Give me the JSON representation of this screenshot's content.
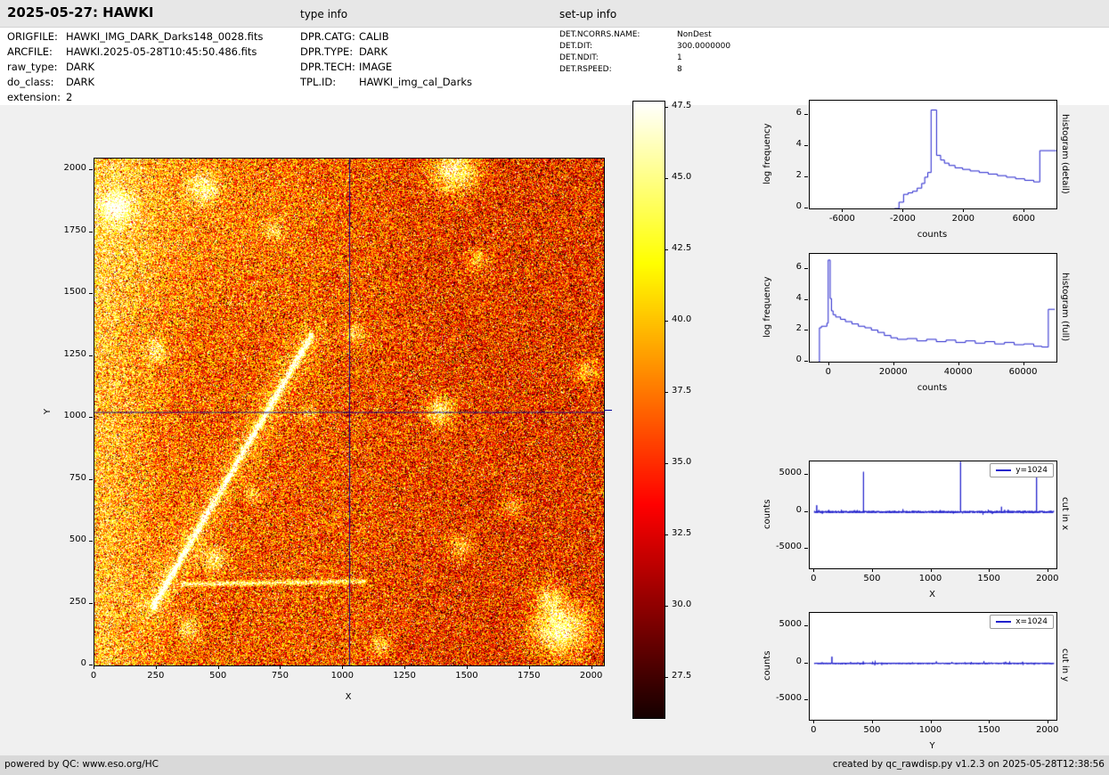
{
  "header": {
    "title": "2025-05-27: HAWKI",
    "type_info_label": "type info",
    "setup_info_label": "set-up info"
  },
  "metadata": {
    "file": [
      {
        "label": "ORIGFILE:",
        "value": "HAWKI_IMG_DARK_Darks148_0028.fits"
      },
      {
        "label": "ARCFILE:",
        "value": "HAWKI.2025-05-28T10:45:50.486.fits"
      },
      {
        "label": "raw_type:",
        "value": "DARK"
      },
      {
        "label": "do_class:",
        "value": "DARK"
      },
      {
        "label": "extension:",
        "value": "2"
      }
    ],
    "dpr": [
      {
        "label": "DPR.CATG:",
        "value": "CALIB"
      },
      {
        "label": "DPR.TYPE:",
        "value": "DARK"
      },
      {
        "label": "DPR.TECH:",
        "value": "IMAGE"
      },
      {
        "label": "TPL.ID:",
        "value": "HAWKI_img_cal_Darks"
      }
    ],
    "det": [
      {
        "label": "DET.NCORRS.NAME:",
        "value": "NonDest"
      },
      {
        "label": "DET.DIT:",
        "value": "300.0000000"
      },
      {
        "label": "DET.NDIT:",
        "value": "1"
      },
      {
        "label": "DET.RSPEED:",
        "value": "8"
      }
    ]
  },
  "main_image": {
    "xlabel": "X",
    "ylabel": "Y",
    "xlim": [
      0,
      2048
    ],
    "ylim": [
      0,
      2048
    ],
    "xticks": [
      0,
      250,
      500,
      750,
      1000,
      1250,
      1500,
      1750,
      2000
    ],
    "yticks": [
      0,
      250,
      500,
      750,
      1000,
      1250,
      1500,
      1750,
      2000
    ],
    "crosshair_x": 1024,
    "crosshair_y": 1024,
    "crosshair_color": "#000099",
    "colormap": "hot",
    "noise": {
      "seed": 42,
      "base": 0.5,
      "blobs": [
        [
          1450,
          1995,
          0.5,
          60
        ],
        [
          1870,
          150,
          0.55,
          75
        ],
        [
          1830,
          280,
          0.3,
          35
        ],
        [
          440,
          1930,
          0.38,
          40
        ],
        [
          90,
          1850,
          0.4,
          45
        ],
        [
          250,
          1270,
          0.28,
          32
        ],
        [
          1390,
          1030,
          0.4,
          42
        ],
        [
          480,
          430,
          0.33,
          38
        ],
        [
          1470,
          480,
          0.28,
          32
        ],
        [
          640,
          690,
          0.24,
          26
        ],
        [
          1050,
          1340,
          0.28,
          28
        ],
        [
          1680,
          640,
          0.24,
          28
        ],
        [
          380,
          150,
          0.3,
          32
        ],
        [
          1150,
          80,
          0.28,
          28
        ],
        [
          860,
          1015,
          0.24,
          24
        ],
        [
          1985,
          1190,
          0.28,
          30
        ],
        [
          1540,
          1640,
          0.25,
          30
        ],
        [
          720,
          1760,
          0.25,
          28
        ]
      ],
      "streaks": [
        [
          235,
          235,
          870,
          1330,
          0.5,
          9
        ],
        [
          235,
          235,
          870,
          1330,
          0.15,
          45
        ],
        [
          360,
          328,
          1085,
          340,
          0.4,
          7
        ]
      ]
    }
  },
  "colorbar": {
    "vmin": 26.1,
    "vmax": 47.72,
    "ticks": [
      27.5,
      30.0,
      32.5,
      35.0,
      37.5,
      40.0,
      42.5,
      45.0,
      47.5
    ]
  },
  "chart_data": [
    {
      "type": "line",
      "id": "hist-detail",
      "ylabel": "log frequency",
      "xlabel": "counts",
      "right_label": "histogram (detail)",
      "color": "#2222cc",
      "xlim": [
        -8200,
        8100
      ],
      "ylim": [
        0,
        6.9
      ],
      "xticks": [
        -6000,
        -2000,
        2000,
        6000
      ],
      "yticks": [
        0,
        2,
        4,
        6
      ],
      "points": [
        [
          -2600,
          0
        ],
        [
          -2300,
          0
        ],
        [
          -2300,
          0.4
        ],
        [
          -2000,
          0.4
        ],
        [
          -2000,
          0.9
        ],
        [
          -1700,
          0.9
        ],
        [
          -1700,
          1.0
        ],
        [
          -1400,
          1.0
        ],
        [
          -1400,
          1.1
        ],
        [
          -1100,
          1.1
        ],
        [
          -1100,
          1.3
        ],
        [
          -800,
          1.3
        ],
        [
          -800,
          1.6
        ],
        [
          -600,
          1.6
        ],
        [
          -600,
          2.0
        ],
        [
          -400,
          2.0
        ],
        [
          -400,
          2.3
        ],
        [
          -180,
          2.3
        ],
        [
          -180,
          6.3
        ],
        [
          180,
          6.3
        ],
        [
          180,
          3.4
        ],
        [
          450,
          3.4
        ],
        [
          450,
          3.1
        ],
        [
          700,
          3.1
        ],
        [
          700,
          2.9
        ],
        [
          1000,
          2.9
        ],
        [
          1000,
          2.75
        ],
        [
          1400,
          2.75
        ],
        [
          1400,
          2.6
        ],
        [
          1900,
          2.6
        ],
        [
          1900,
          2.5
        ],
        [
          2400,
          2.5
        ],
        [
          2400,
          2.4
        ],
        [
          3000,
          2.4
        ],
        [
          3000,
          2.3
        ],
        [
          3600,
          2.3
        ],
        [
          3600,
          2.2
        ],
        [
          4200,
          2.2
        ],
        [
          4200,
          2.1
        ],
        [
          4800,
          2.1
        ],
        [
          4800,
          2.0
        ],
        [
          5400,
          2.0
        ],
        [
          5400,
          1.9
        ],
        [
          6000,
          1.9
        ],
        [
          6000,
          1.8
        ],
        [
          6600,
          1.8
        ],
        [
          6600,
          1.7
        ],
        [
          7000,
          1.7
        ],
        [
          7000,
          3.7
        ],
        [
          8100,
          3.7
        ]
      ]
    },
    {
      "type": "line",
      "id": "hist-full",
      "ylabel": "log frequency",
      "xlabel": "counts",
      "right_label": "histogram (full)",
      "color": "#2222cc",
      "xlim": [
        -6000,
        70000
      ],
      "ylim": [
        0,
        7.0
      ],
      "xticks": [
        0,
        20000,
        40000,
        60000
      ],
      "yticks": [
        0,
        2,
        4,
        6
      ],
      "points": [
        [
          -3200,
          0
        ],
        [
          -3000,
          0
        ],
        [
          -3000,
          2.2
        ],
        [
          -2400,
          2.2
        ],
        [
          -2400,
          2.3
        ],
        [
          -700,
          2.3
        ],
        [
          -700,
          2.5
        ],
        [
          -300,
          2.5
        ],
        [
          -300,
          6.6
        ],
        [
          300,
          6.6
        ],
        [
          300,
          4.1
        ],
        [
          700,
          4.1
        ],
        [
          700,
          3.3
        ],
        [
          1200,
          3.3
        ],
        [
          1200,
          3.05
        ],
        [
          2000,
          3.05
        ],
        [
          2000,
          2.9
        ],
        [
          3500,
          2.9
        ],
        [
          3500,
          2.75
        ],
        [
          5000,
          2.75
        ],
        [
          5000,
          2.6
        ],
        [
          7000,
          2.6
        ],
        [
          7000,
          2.45
        ],
        [
          9000,
          2.45
        ],
        [
          9000,
          2.3
        ],
        [
          11000,
          2.3
        ],
        [
          11000,
          2.2
        ],
        [
          13000,
          2.2
        ],
        [
          13000,
          2.05
        ],
        [
          15000,
          2.05
        ],
        [
          15000,
          1.9
        ],
        [
          17000,
          1.9
        ],
        [
          17000,
          1.7
        ],
        [
          19000,
          1.7
        ],
        [
          19000,
          1.55
        ],
        [
          21000,
          1.55
        ],
        [
          21000,
          1.45
        ],
        [
          24000,
          1.45
        ],
        [
          24000,
          1.5
        ],
        [
          27000,
          1.5
        ],
        [
          27000,
          1.35
        ],
        [
          30000,
          1.35
        ],
        [
          30000,
          1.45
        ],
        [
          33000,
          1.45
        ],
        [
          33000,
          1.3
        ],
        [
          36000,
          1.3
        ],
        [
          36000,
          1.4
        ],
        [
          39000,
          1.4
        ],
        [
          39000,
          1.25
        ],
        [
          42000,
          1.25
        ],
        [
          42000,
          1.35
        ],
        [
          45000,
          1.35
        ],
        [
          45000,
          1.2
        ],
        [
          48000,
          1.2
        ],
        [
          48000,
          1.3
        ],
        [
          51000,
          1.3
        ],
        [
          51000,
          1.15
        ],
        [
          54000,
          1.15
        ],
        [
          54000,
          1.25
        ],
        [
          57000,
          1.25
        ],
        [
          57000,
          1.1
        ],
        [
          60000,
          1.1
        ],
        [
          60000,
          1.15
        ],
        [
          63000,
          1.15
        ],
        [
          63000,
          1.0
        ],
        [
          65500,
          1.0
        ],
        [
          65500,
          0.95
        ],
        [
          67500,
          0.95
        ],
        [
          67500,
          3.4
        ],
        [
          69500,
          3.4
        ]
      ]
    },
    {
      "type": "line",
      "id": "cut-x",
      "legend": "y=1024",
      "ylabel": "counts",
      "xlabel": "X",
      "right_label": "cut in x",
      "color": "#2222cc",
      "xlim": [
        -40,
        2070
      ],
      "ylim": [
        -7600,
        6800
      ],
      "xticks": [
        0,
        500,
        1000,
        1500,
        2000
      ],
      "yticks": [
        -5000,
        0,
        5000
      ],
      "n_points": 2048,
      "noise_amp": 130,
      "seed": 7,
      "spikes": [
        [
          20,
          900
        ],
        [
          420,
          5400
        ],
        [
          1250,
          6750
        ],
        [
          1600,
          700
        ],
        [
          1900,
          6300
        ]
      ]
    },
    {
      "type": "line",
      "id": "cut-y",
      "legend": "x=1024",
      "ylabel": "counts",
      "xlabel": "Y",
      "right_label": "cut in y",
      "color": "#2222cc",
      "xlim": [
        -40,
        2070
      ],
      "ylim": [
        -7600,
        6800
      ],
      "xticks": [
        0,
        500,
        1000,
        1500,
        2000
      ],
      "yticks": [
        -5000,
        0,
        5000
      ],
      "n_points": 2048,
      "noise_amp": 90,
      "seed": 11,
      "spikes": [
        [
          150,
          900
        ],
        [
          520,
          350
        ],
        [
          1450,
          300
        ]
      ]
    }
  ],
  "footer": {
    "left": "powered by QC: www.eso.org/HC",
    "right": "created by qc_rawdisp.py v1.2.3 on 2025-05-28T12:38:56"
  }
}
